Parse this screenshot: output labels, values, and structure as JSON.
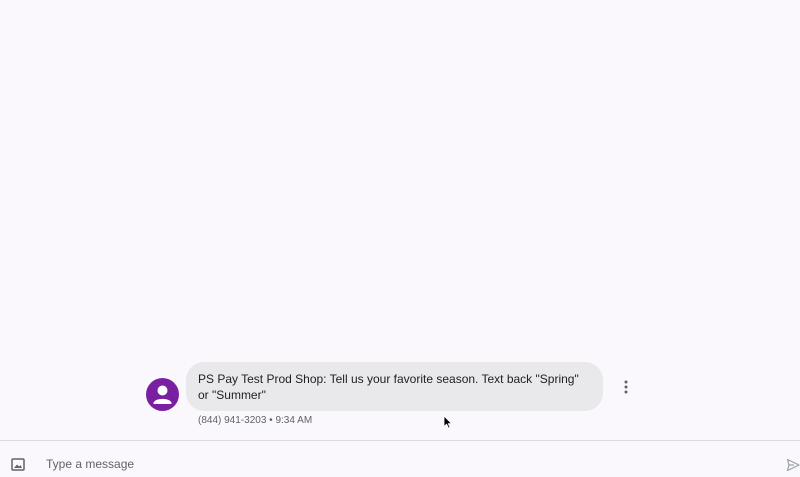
{
  "thread": {
    "message": {
      "text": "PS Pay Test Prod Shop: Tell us your favorite season. Text back \"Spring\" or \"Summer\"",
      "sender": "(844) 941-3203",
      "separator": "•",
      "time": "9:34 AM"
    }
  },
  "composer": {
    "placeholder": "Type a message"
  },
  "icons": {
    "avatar": "person-icon",
    "more": "more-vert-icon",
    "attach": "image-icon",
    "send": "send-icon"
  },
  "colors": {
    "avatar": "#7b1fa2",
    "bubble": "#e9e9ec",
    "background": "#faf8fc"
  }
}
